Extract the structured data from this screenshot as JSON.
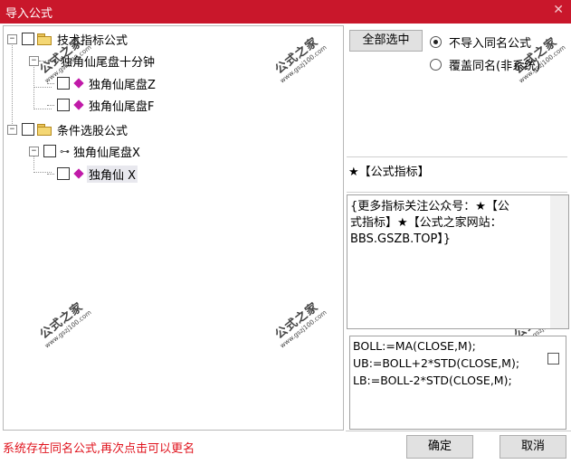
{
  "window": {
    "title": "导入公式",
    "close_glyph": "✕"
  },
  "tree": {
    "group1": {
      "label": "技术指标公式",
      "expand_glyph": "⊟"
    },
    "group1_child": {
      "label": "独角仙尾盘十分钟"
    },
    "group1_grandchildren": [
      {
        "label": "独角仙尾盘Z"
      },
      {
        "label": "独角仙尾盘F"
      }
    ],
    "group2": {
      "label": "条件选股公式",
      "expand_glyph": "⊟"
    },
    "group2_child": {
      "label": "独角仙尾盘X"
    },
    "group2_grandchild": {
      "label": "独角仙 X"
    }
  },
  "watermark": {
    "text_cn": "公式之家",
    "text_url": "www.gszj100.com"
  },
  "options": {
    "select_all_label": "全部选中",
    "radio_skip_label": "不导入同名公式",
    "radio_overwrite_label": "覆盖同名(非系统)",
    "selected_radio": "skip"
  },
  "description_title": "★【公式指标】",
  "description_text": "{更多指标关注公众号：★【公式指标】★【公式之家网站：BBS.GSZB.TOP】}",
  "description_lines": [
    "{更多指标关注公众号：★【公",
    "式指标】★【公式之家网站：",
    "BBS.GSZB.TOP】}"
  ],
  "formula_lines": [
    "BOLL:=MA(CLOSE,M);",
    "UB:=BOLL+2*STD(CLOSE,M);",
    "LB:=BOLL-2*STD(CLOSE,M);"
  ],
  "status_text": "系统存在同名公式,再次点击可以更名",
  "buttons": {
    "ok_label": "确定",
    "cancel_label": "取消"
  },
  "colors": {
    "titlebar": "#c9172b",
    "status_text": "#e0141e",
    "formula_icon": "#c01aa8"
  }
}
